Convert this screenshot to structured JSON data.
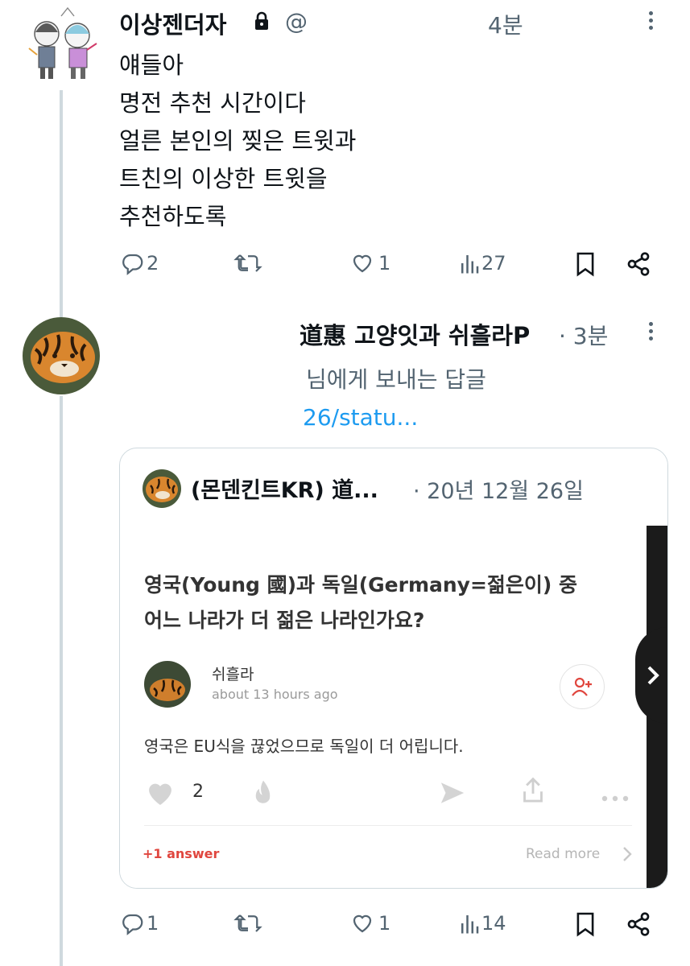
{
  "tweet1": {
    "display_name": "이상젠더자",
    "handle_prefix": "@",
    "time": "4분",
    "lines": [
      "얘들아",
      "명전 추천 시간이다",
      "얼른 본인의 찢은 트윗과",
      "트친의 이상한 트윗을",
      "추천하도록"
    ],
    "replies": "2",
    "likes": "1",
    "views": "27"
  },
  "tweet2": {
    "display_name_visible": "道惠 고양잇과 쉬흘라P",
    "time": "· 3분",
    "reply_to": "님에게 보내는 답글",
    "link_fragment": "26/statu...",
    "replies": "1",
    "likes": "1",
    "views": "14"
  },
  "quote": {
    "name": "(몬덴킨트KR) 道...",
    "date": "· 20년 12월 26일",
    "question_line1": "영국(Young 國)과 독일(Germany=젊은이) 중",
    "question_line2": "어느 나라가 더 젊은 나라인가요?",
    "answerer_name": "쉬흘라",
    "answer_time": "about 13 hours ago",
    "answer_text": "영국은 EU식을 끊었으므로 독일이 더 어립니다.",
    "like_count": "2",
    "more_answers": "+1 answer",
    "read_more": "Read more"
  },
  "icons": {
    "reply": "reply-icon",
    "retweet": "retweet-icon",
    "like": "heart-icon",
    "views": "views-icon",
    "bookmark": "bookmark-icon",
    "share": "share-icon",
    "lock": "lock-icon",
    "more": "more-vertical-icon"
  },
  "colors": {
    "text": "#0f1419",
    "secondary": "#536471",
    "link": "#1d9bf0",
    "thread_line": "#cfd9de",
    "answer_accent": "#e0463e"
  }
}
